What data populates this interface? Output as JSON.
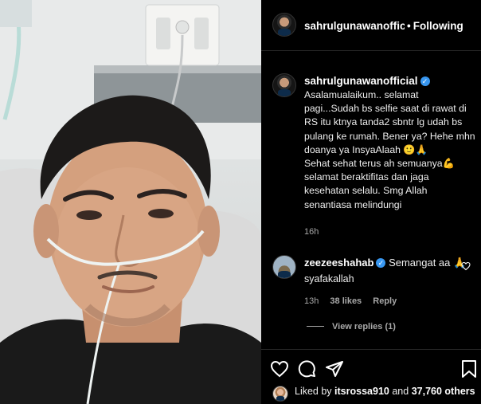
{
  "post": {
    "username": "sahrulgunawanofficial",
    "separator": "•",
    "follow_state": "Following"
  },
  "caption": {
    "username": "sahrulgunawanofficial",
    "text": "Asalamualaikum.. selamat\npagi...Sudah bs selfie saat di rawat di\nRS itu ktnya tanda2 sbntr lg udah bs\npulang ke rumah. Bener ya? Hehe mhn\ndoanya ya InsyaAlaah 🙂🙏\nSehat sehat terus ah semuanya💪\nselamat beraktifitas dan jaga\nkesehatan selalu. Smg Allah\nsenantiasa melindungi",
    "time": "16h"
  },
  "comment": {
    "username": "zeezeeshahab",
    "text_line1": "Semangat aa 🙏",
    "text_line2": "syafakallah",
    "time": "13h",
    "likes": "38 likes",
    "reply": "Reply",
    "view_replies": "View replies (1)"
  },
  "footer": {
    "liked_by_prefix": "Liked by",
    "liked_by_user": "itsrossa910",
    "liked_by_and": "and",
    "liked_by_others": "37,760 others"
  },
  "icons": {
    "like": "heart-icon",
    "comment": "comment-icon",
    "share": "send-icon",
    "save": "bookmark-icon",
    "verified": "verified-badge-icon"
  },
  "colors": {
    "background": "#000000",
    "verified": "#3897f0",
    "muted_text": "#a8a8a8"
  }
}
